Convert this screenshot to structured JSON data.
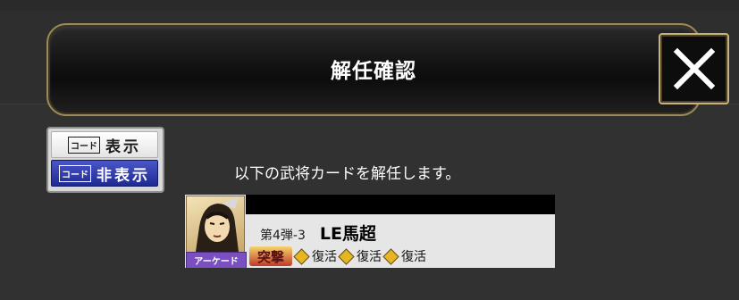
{
  "header": {
    "title": "解任確認",
    "close_icon": "close-x-icon"
  },
  "code_toggle": {
    "tag": "コード",
    "show_label": "表示",
    "hide_label": "非表示",
    "selected": "hide"
  },
  "message": "以下の武将カードを解任します。",
  "card": {
    "set": "第4弾-3",
    "name": "LE馬超",
    "rarity_label": "アーケード",
    "skill_badge": "突撃",
    "skills": [
      "復活",
      "復活",
      "復活"
    ]
  },
  "colors": {
    "background": "#313131",
    "banner_border": "#9c8a5a",
    "toggle_active": "#1f2a92",
    "rarity_badge": "#7a4fc1",
    "skill_diamond": "#e6b520"
  }
}
